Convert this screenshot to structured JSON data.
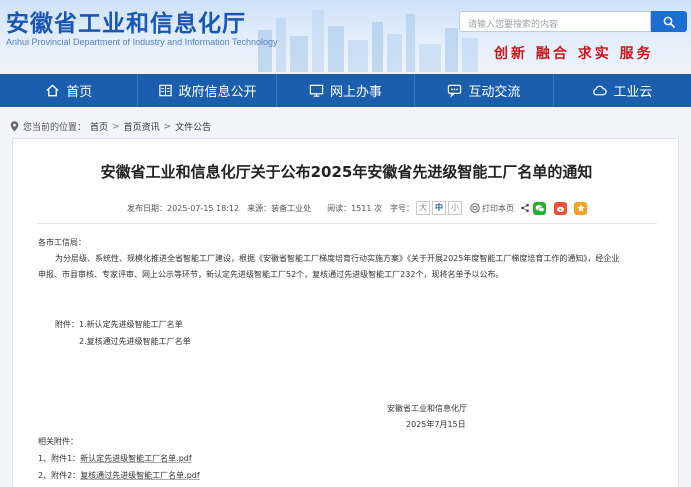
{
  "header": {
    "site_title": "安徽省工业和信息化厅",
    "site_subtitle": "Anhui Provincial Department of Industry and Information Technology",
    "search_placeholder": "请输入您要搜索的内容",
    "slogan": "创新 融合 求实 服务"
  },
  "nav": {
    "items": [
      {
        "label": "首页",
        "icon": "home-icon"
      },
      {
        "label": "政府信息公开",
        "icon": "document-list-icon"
      },
      {
        "label": "网上办事",
        "icon": "monitor-icon"
      },
      {
        "label": "互动交流",
        "icon": "chat-icon"
      },
      {
        "label": "工业云",
        "icon": "cloud-icon"
      }
    ]
  },
  "breadcrumb": {
    "prefix": "您当前的位置：",
    "items": [
      "首页",
      "首页资讯",
      "文件公告"
    ],
    "separator": ">"
  },
  "article": {
    "title": "安徽省工业和信息化厅关于公布2025年安徽省先进级智能工厂名单的通知",
    "meta": {
      "date_label": "发布日期：",
      "date": "2025-07-15 18:12",
      "source_label": "来源：",
      "source": "装备工业处",
      "views_label": "阅读：",
      "views": "1511 次",
      "font_label": "字号：",
      "font_sizes": [
        "大",
        "中",
        "小"
      ],
      "print_label": "打印本页"
    },
    "salutation": "各市工信局：",
    "paragraph_line1": "为分层级、系统性、规模化推进全省智能工厂建设，根据《安徽省智能工厂梯度培育行动实施方案》《关于开展2025年度智能工厂梯度培育工作的通知》，经企业",
    "paragraph_line2": "申报、市县审核、专家评审、网上公示等环节，新认定先进级智能工厂52个，复核通过先进级智能工厂232个，现将名单予以公布。",
    "attachments_inline_label": "附件：",
    "attachments_inline": [
      "1.新认定先进级智能工厂名单",
      "2.复核通过先进级智能工厂名单"
    ],
    "signature_org": "安徽省工业和信息化厅",
    "signature_date": "2025年7月15日",
    "related_label": "相关附件：",
    "related_files": [
      {
        "prefix": "1、附件1：",
        "name": "新认定先进级智能工厂名单.pdf"
      },
      {
        "prefix": "2、附件2：",
        "name": "复核通过先进级智能工厂名单.pdf"
      }
    ]
  },
  "colors": {
    "nav_bg": "#1a5ead",
    "title_blue": "#1a56b5",
    "slogan_red": "#c8171c",
    "wechat_green": "#2aae34",
    "weibo_orange": "#e8503a",
    "qzone_yellow": "#f0a224"
  }
}
